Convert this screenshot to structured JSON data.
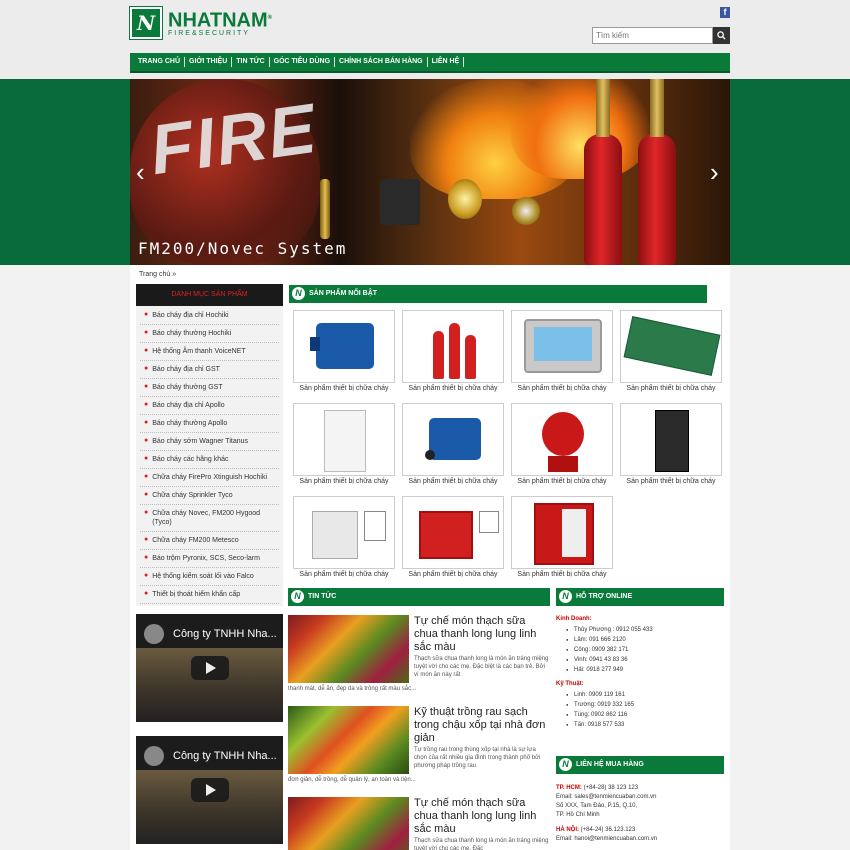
{
  "header": {
    "logo_name": "NHATNAM",
    "logo_reg": "®",
    "logo_sub": "FIRE&SECURITY",
    "logo_mark": "N",
    "facebook_icon_label": "f",
    "search": {
      "placeholder": "Tìm kiếm",
      "button_icon": "search-icon"
    }
  },
  "nav": {
    "items": [
      "TRANG CHỦ",
      "GIỚI THIỆU",
      "TIN TỨC",
      "GÓC TIÊU DÙNG",
      "CHÍNH SÁCH BÁN HÀNG",
      "LIÊN HỆ"
    ]
  },
  "slider": {
    "headline": "FIRE",
    "caption": "FM200/Novec System",
    "prev_icon": "‹",
    "next_icon": "›"
  },
  "breadcrumb": {
    "text": "Trang chủ »"
  },
  "sidebar": {
    "heading": "DANH MỤC SẢN PHẨM",
    "items": [
      "Báo cháy địa chỉ Hochiki",
      "Báo cháy thường Hochiki",
      "Hệ thống Âm thanh VoiceNET",
      "Báo cháy địa chỉ GST",
      "Báo cháy thường GST",
      "Báo cháy địa chỉ Apollo",
      "Báo cháy thường Apollo",
      "Báo cháy sớm Wagner Titanus",
      "Báo cháy các hãng khác",
      "Chữa cháy FirePro Xtinguish Hochiki",
      "Chữa cháy Sprinkler Tyco",
      "Chữa cháy Novec, FM200 Hygood (Tyco)",
      "Chữa cháy FM200 Metesco",
      "Báo trộm Pyronix, SCS, Seco-larm",
      "Hệ thống kiểm soát lối vào Falco",
      "Thiết bị thoát hiểm khẩn cấp"
    ]
  },
  "featured": {
    "heading": "SẢN PHẨM NỔI BẬT",
    "products": [
      "Sản phẩm thiết bị chữa cháy",
      "Sản phẩm thiết bị chữa cháy",
      "Sản phẩm thiết bị chữa cháy",
      "Sản phẩm thiết bị chữa cháy",
      "Sản phẩm thiết bị chữa cháy",
      "Sản phẩm thiết bị chữa cháy",
      "Sản phẩm thiết bị chữa cháy",
      "Sản phẩm thiết bị chữa cháy",
      "Sản phẩm thiết bị chữa cháy",
      "Sản phẩm thiết bị chữa cháy",
      "Sản phẩm thiết bị chữa cháy"
    ]
  },
  "videos": [
    {
      "title": "Công ty TNHH Nha..."
    },
    {
      "title": "Công ty TNHH Nha..."
    }
  ],
  "news": {
    "heading": "TIN TỨC",
    "items": [
      {
        "title": "Tự chế món thạch sữa chua thanh long lung linh sắc màu",
        "desc": "Thạch sữa chua thanh long là món ăn tráng miệng tuyệt vời cho các mẹ. Đặc biệt là các bạn trẻ. Bởi vì món ăn này rất",
        "rest": "thanh mát, dễ ăn, đẹp da và trông rất màu sắc..."
      },
      {
        "title": "Kỹ thuật trồng rau sạch trong chậu xốp tại nhà đơn giản",
        "desc": "Tự trồng rau trong thùng xốp tại nhà là sự lựa chọn của rất nhiều gia đình trong thành phố bởi phương pháp trồng rau",
        "rest": "đơn giản, dễ trồng, dễ quản lý, an toàn và tiện..."
      },
      {
        "title": "Tự chế món thạch sữa chua thanh long lung linh sắc màu",
        "desc": "Thạch sữa chua thanh long là món ăn tráng miệng tuyệt vời cho các mẹ. Đặc",
        "rest": ""
      }
    ]
  },
  "support": {
    "heading": "HỖ TRỢ ONLINE",
    "sales_label": "Kinh Doanh:",
    "sales": [
      "Thủy Phương : 0912 055 433",
      "Lâm: 091 666 2120",
      "Công: 0909 382 171",
      "Vinh: 0941 43 83 36",
      "Hải: 0918 277 949"
    ],
    "tech_label": "Kỹ Thuật:",
    "tech": [
      "Linh: 0909 119 161",
      "Trường: 0919 332 165",
      "Tùng: 0902 862 116",
      "Tấn: 0918 577 533"
    ]
  },
  "contact": {
    "heading": "LIÊN HỆ MUA HÀNG",
    "hcm_label": "TP. HCM:",
    "hcm_phone": "(+84-28) 38 123 123",
    "hcm_email": "Email: sales@tenmiencuaban.com.vn",
    "hcm_addr1": "Số XXX, Tam Đảo, P.15, Q.10,",
    "hcm_addr2": "TP. Hồ Chí Minh",
    "hn_label": "HÀ NỘI:",
    "hn_phone": "(+84-24) 36.123.123",
    "hn_email": "Email: hanoi@tenmiencuaban.com.vn"
  },
  "colors": {
    "brand_green": "#0a7a3a",
    "accent_red": "#e02020"
  }
}
